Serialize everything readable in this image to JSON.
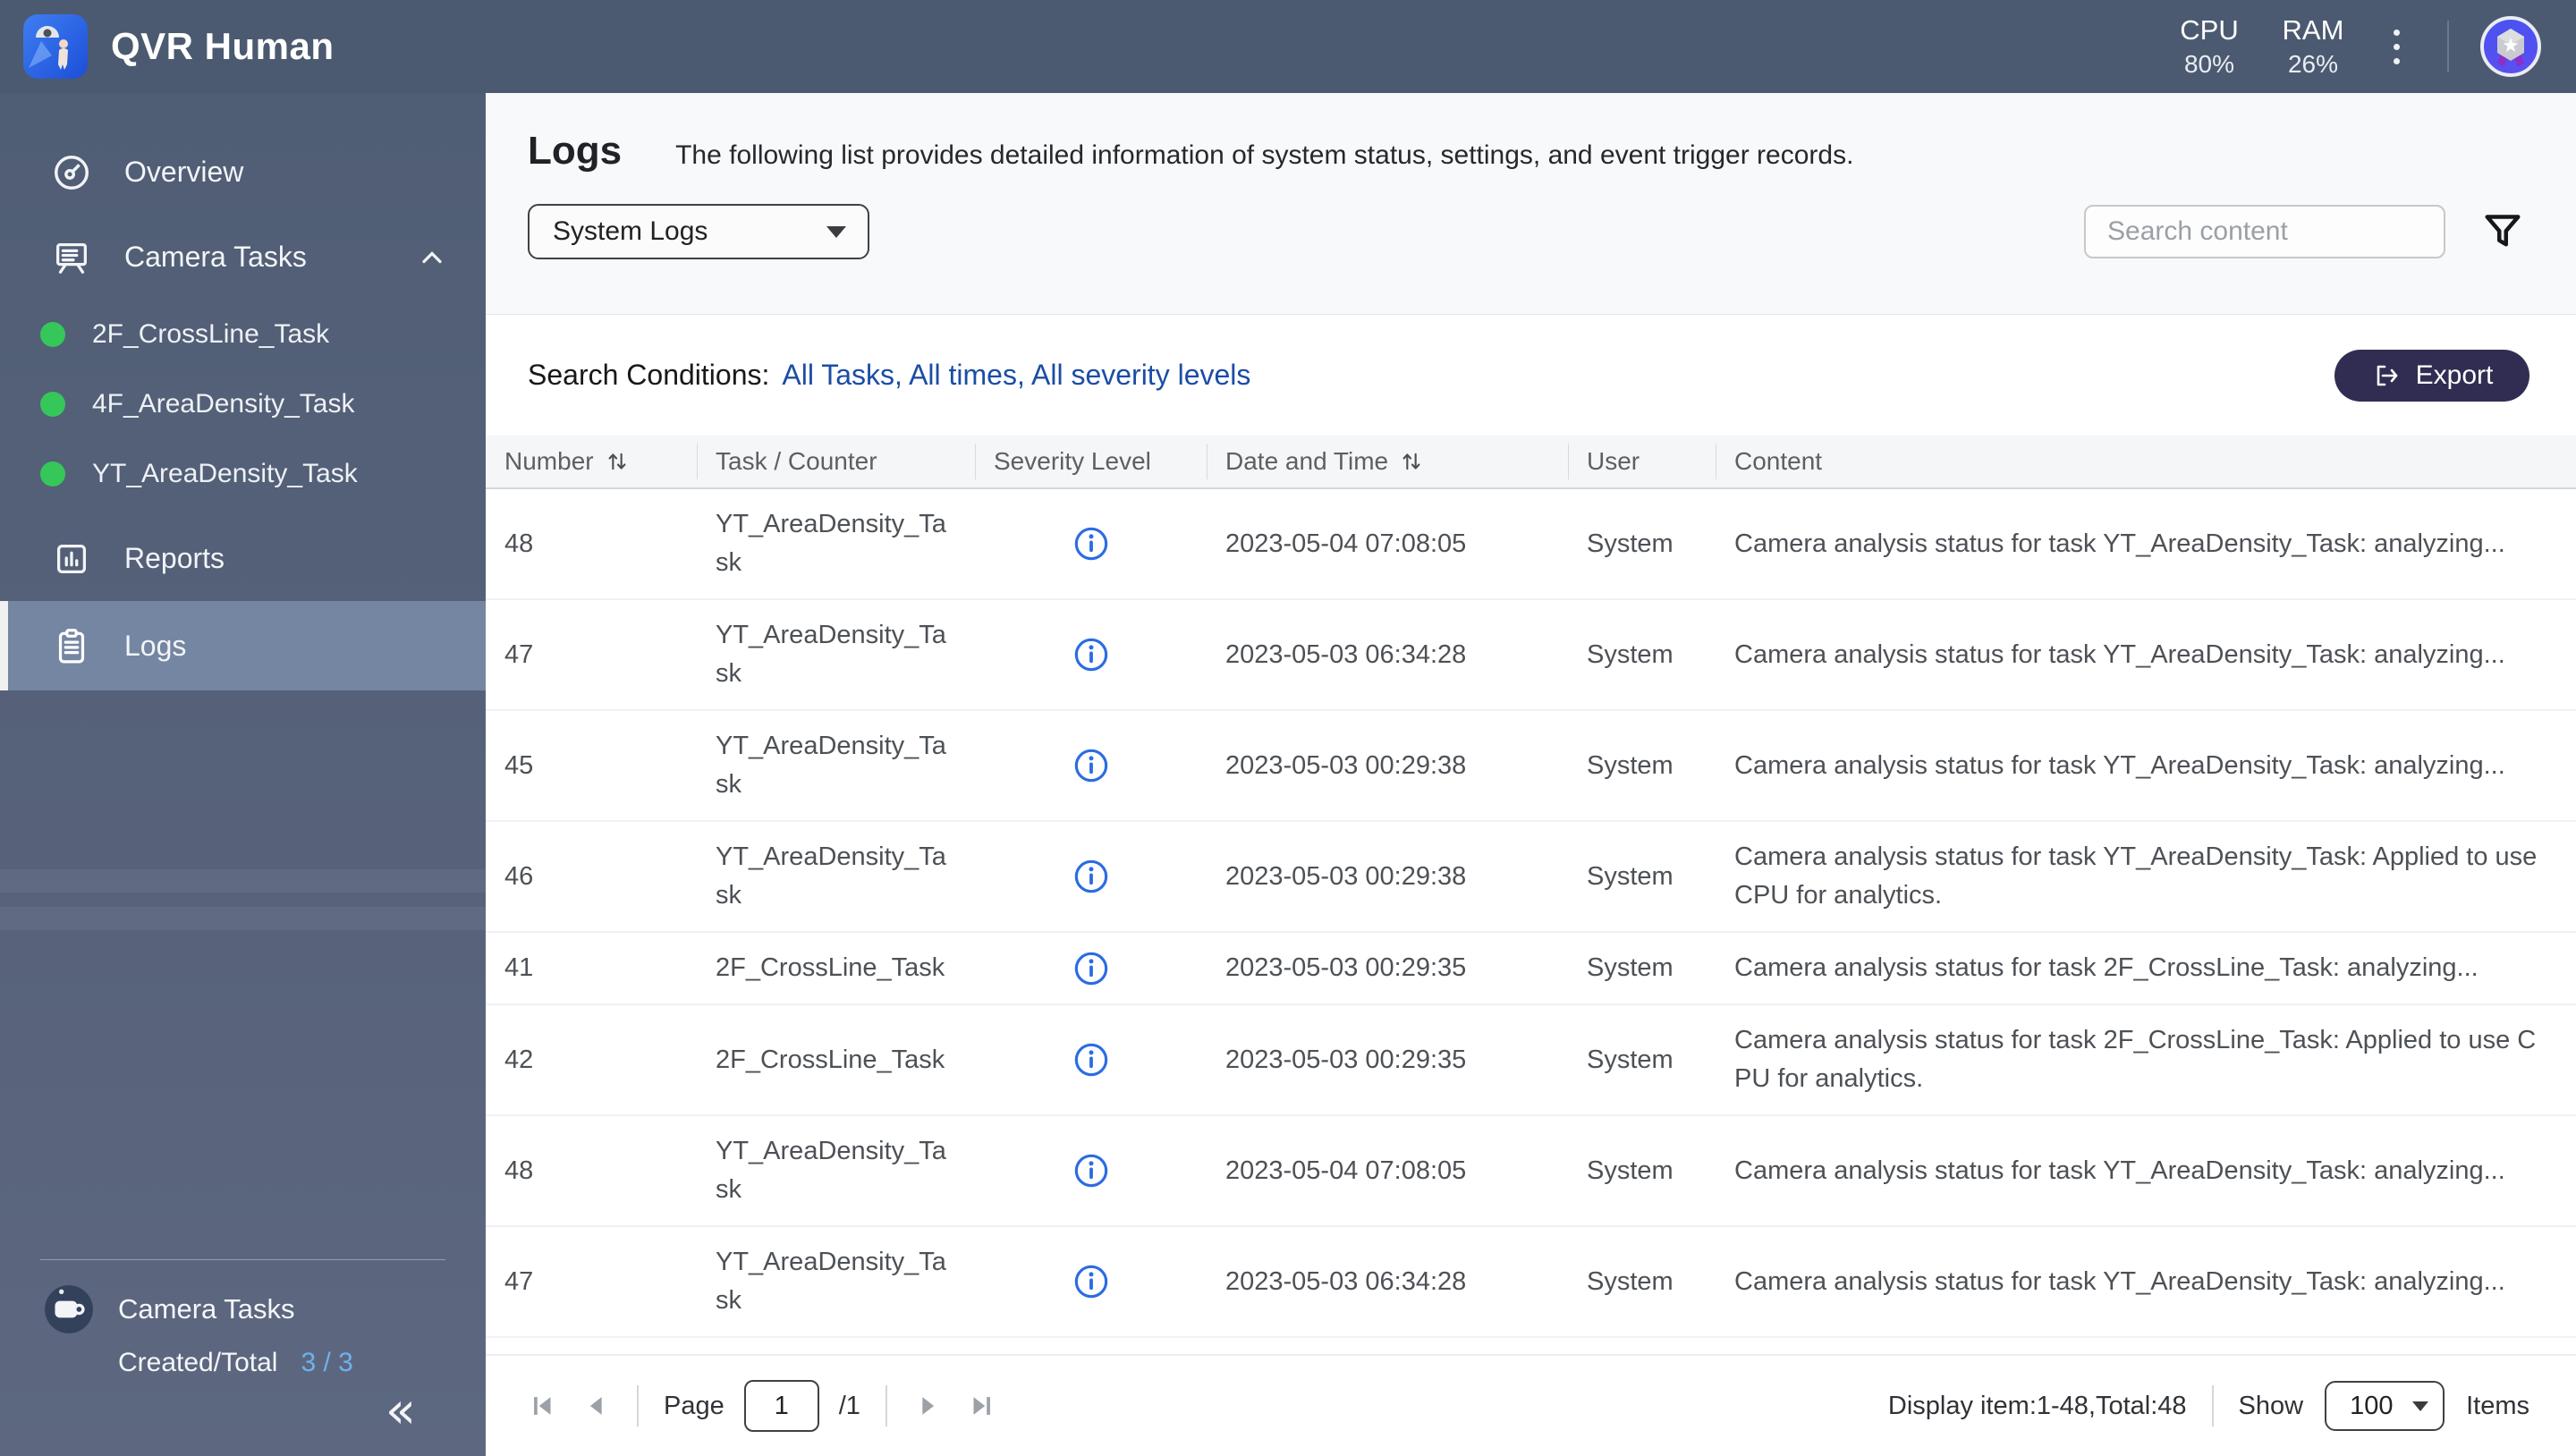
{
  "topbar": {
    "app_title": "QVR Human",
    "cpu_label": "CPU",
    "cpu_value": "80%",
    "ram_label": "RAM",
    "ram_value": "26%"
  },
  "sidebar": {
    "items": [
      {
        "label": "Overview"
      },
      {
        "label": "Camera Tasks"
      },
      {
        "label": "Reports"
      },
      {
        "label": "Logs"
      }
    ],
    "tasks": [
      {
        "label": "2F_CrossLine_Task",
        "status": "running"
      },
      {
        "label": "4F_AreaDensity_Task",
        "status": "running"
      },
      {
        "label": "YT_AreaDensity_Task",
        "status": "running"
      }
    ],
    "footer": {
      "title": "Camera Tasks",
      "created_total_label": "Created/Total",
      "created_total_value": "3 / 3"
    }
  },
  "page": {
    "title": "Logs",
    "description": "The following list provides detailed information of system status, settings, and event trigger records.",
    "log_type_selected": "System Logs",
    "search_placeholder": "Search content",
    "conditions_label": "Search Conditions:",
    "conditions_value": "All Tasks, All times, All severity levels",
    "export_label": "Export"
  },
  "table": {
    "columns": [
      "Number",
      "Task / Counter",
      "Severity Level",
      "Date and Time",
      "User",
      "Content"
    ],
    "rows": [
      {
        "number": "48",
        "task": "YT_AreaDensity_Task",
        "severity": "information",
        "datetime": "2023-05-04 07:08:05",
        "user": "System",
        "content": "Camera analysis status for task YT_AreaDensity_Task: analyzing..."
      },
      {
        "number": "47",
        "task": "YT_AreaDensity_Task",
        "severity": "information",
        "datetime": "2023-05-03 06:34:28",
        "user": "System",
        "content": "Camera analysis status for task YT_AreaDensity_Task: analyzing..."
      },
      {
        "number": "45",
        "task": "YT_AreaDensity_Task",
        "severity": "information",
        "datetime": "2023-05-03 00:29:38",
        "user": "System",
        "content": "Camera analysis status for task YT_AreaDensity_Task: analyzing..."
      },
      {
        "number": "46",
        "task": "YT_AreaDensity_Task",
        "severity": "information",
        "datetime": "2023-05-03 00:29:38",
        "user": "System",
        "content": "Camera analysis status for task YT_AreaDensity_Task: Applied to use CPU for analytics."
      },
      {
        "number": "41",
        "task": "2F_CrossLine_Task",
        "severity": "information",
        "datetime": "2023-05-03 00:29:35",
        "user": "System",
        "content": "Camera analysis status for task 2F_CrossLine_Task: analyzing..."
      },
      {
        "number": "42",
        "task": "2F_CrossLine_Task",
        "severity": "information",
        "datetime": "2023-05-03 00:29:35",
        "user": "System",
        "content": "Camera analysis status for task 2F_CrossLine_Task: Applied to use CPU for analytics."
      },
      {
        "number": "48",
        "task": "YT_AreaDensity_Task",
        "severity": "information",
        "datetime": "2023-05-04 07:08:05",
        "user": "System",
        "content": "Camera analysis status for task YT_AreaDensity_Task: analyzing..."
      },
      {
        "number": "47",
        "task": "YT_AreaDensity_Task",
        "severity": "information",
        "datetime": "2023-05-03 06:34:28",
        "user": "System",
        "content": "Camera analysis status for task YT_AreaDensity_Task: analyzing..."
      }
    ]
  },
  "pagination": {
    "page_label": "Page",
    "page_value": "1",
    "page_total": "/1",
    "display_info": "Display item:1-48,Total:48",
    "show_label": "Show",
    "show_value": "100",
    "items_label": "Items"
  },
  "colors": {
    "topbar_bg": "#4b5a70",
    "sidebar_selected_bg": "#7486a1",
    "task_status_green": "#35c759",
    "link_blue": "#1b4da5",
    "info_icon_blue": "#2b6ce2",
    "export_button_bg": "#312d52",
    "created_total_blue": "#6fb1ec"
  }
}
